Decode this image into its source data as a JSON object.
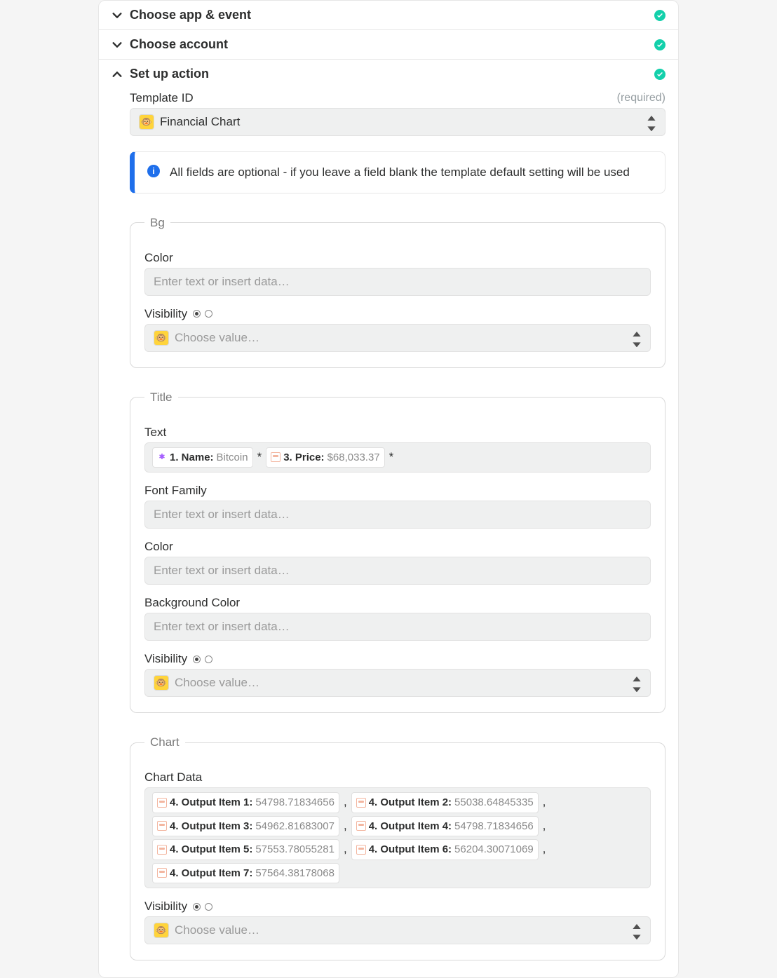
{
  "sections": {
    "chooseApp": {
      "title": "Choose app & event"
    },
    "chooseAccount": {
      "title": "Choose account"
    },
    "setupAction": {
      "title": "Set up action"
    }
  },
  "templateId": {
    "label": "Template ID",
    "required": "(required)",
    "value": "Financial Chart"
  },
  "info": {
    "text": "All fields are optional - if you leave a field blank the template default setting will be used"
  },
  "groups": {
    "bg": {
      "legend": "Bg",
      "color": {
        "label": "Color",
        "placeholder": "Enter text or insert data…"
      },
      "visibility": {
        "label": "Visibility",
        "placeholder": "Choose value…"
      }
    },
    "title": {
      "legend": "Title",
      "text": {
        "label": "Text",
        "pill1": {
          "label": "1. Name:",
          "value": "Bitcoin"
        },
        "star1": "*",
        "pill2": {
          "label": "3. Price:",
          "value": "$68,033.37"
        },
        "star2": "*"
      },
      "fontFamily": {
        "label": "Font Family",
        "placeholder": "Enter text or insert data…"
      },
      "color": {
        "label": "Color",
        "placeholder": "Enter text or insert data…"
      },
      "bgColor": {
        "label": "Background Color",
        "placeholder": "Enter text or insert data…"
      },
      "visibility": {
        "label": "Visibility",
        "placeholder": "Choose value…"
      }
    },
    "chart": {
      "legend": "Chart",
      "data": {
        "label": "Chart Data",
        "items": [
          {
            "label": "4. Output Item 1:",
            "value": "54798.71834656"
          },
          {
            "label": "4. Output Item 2:",
            "value": "55038.64845335"
          },
          {
            "label": "4. Output Item 3:",
            "value": "54962.81683007"
          },
          {
            "label": "4. Output Item 4:",
            "value": "54798.71834656"
          },
          {
            "label": "4. Output Item 5:",
            "value": "57553.78055281"
          },
          {
            "label": "4. Output Item 6:",
            "value": "56204.30071069"
          },
          {
            "label": "4. Output Item 7:",
            "value": "57564.38178068"
          }
        ]
      },
      "visibility": {
        "label": "Visibility",
        "placeholder": "Choose value…"
      }
    }
  }
}
